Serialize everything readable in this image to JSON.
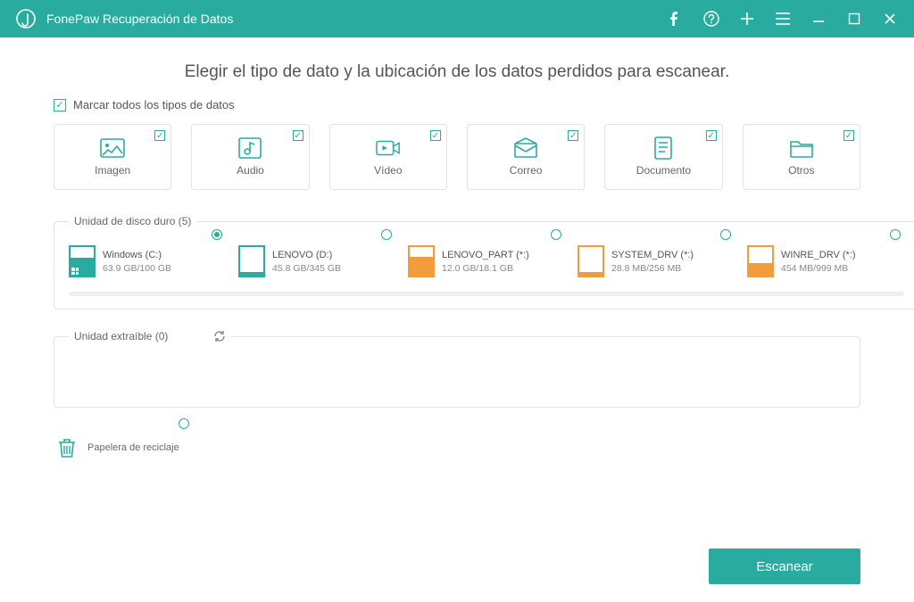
{
  "app": {
    "title": "FonePaw Recuperación de Datos"
  },
  "heading": "Elegir el tipo de dato y la ubicación de los datos perdidos para escanear.",
  "checkAllLabel": "Marcar todos los tipos de datos",
  "types": [
    {
      "id": "image",
      "label": "Imagen",
      "checked": true
    },
    {
      "id": "audio",
      "label": "Audio",
      "checked": true
    },
    {
      "id": "video",
      "label": "Vídeo",
      "checked": true
    },
    {
      "id": "mail",
      "label": "Correo",
      "checked": true
    },
    {
      "id": "document",
      "label": "Documento",
      "checked": true
    },
    {
      "id": "others",
      "label": "Otros",
      "checked": true
    }
  ],
  "hdd": {
    "legend": "Unidad de disco duro (5)",
    "drives": [
      {
        "name": "Windows (C:)",
        "size": "63.9 GB/100 GB",
        "color": "teal",
        "fill": 64,
        "selected": true,
        "winlogo": true
      },
      {
        "name": "LENOVO (D:)",
        "size": "45.8 GB/345 GB",
        "color": "teal",
        "fill": 13,
        "selected": false
      },
      {
        "name": "LENOVO_PART (*:)",
        "size": "12.0 GB/18.1 GB",
        "color": "orange",
        "fill": 66,
        "selected": false
      },
      {
        "name": "SYSTEM_DRV (*:)",
        "size": "28.8 MB/256 MB",
        "color": "orange",
        "fill": 11,
        "selected": false
      },
      {
        "name": "WINRE_DRV (*:)",
        "size": "454 MB/999 MB",
        "color": "orange",
        "fill": 45,
        "selected": false
      }
    ]
  },
  "removable": {
    "legend": "Unidad extraíble (0)"
  },
  "recycle": {
    "label": "Papelera de reciclaje"
  },
  "buttons": {
    "scan": "Escanear"
  }
}
